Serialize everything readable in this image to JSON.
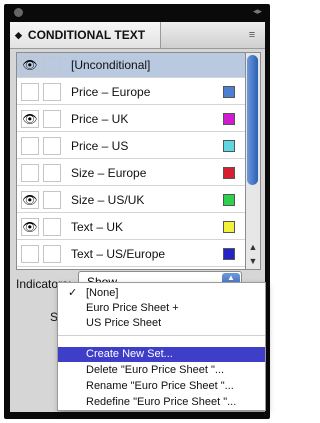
{
  "panel": {
    "title": "CONDITIONAL TEXT",
    "menu_icon": "panel-menu-icon"
  },
  "conditions": [
    {
      "label": "[Unconditional]",
      "visible": true,
      "highlighted": true,
      "color": null
    },
    {
      "label": "Price – Europe",
      "visible": false,
      "highlighted": false,
      "color": "#4a7fd4"
    },
    {
      "label": "Price – UK",
      "visible": true,
      "highlighted": false,
      "color": "#d21ad2"
    },
    {
      "label": "Price – US",
      "visible": false,
      "highlighted": false,
      "color": "#5fd7e0"
    },
    {
      "label": "Size – Europe",
      "visible": false,
      "highlighted": false,
      "color": "#d81f2f"
    },
    {
      "label": "Size – US/UK",
      "visible": true,
      "highlighted": false,
      "color": "#2ed14b"
    },
    {
      "label": "Text – UK",
      "visible": true,
      "highlighted": false,
      "color": "#f2f23a"
    },
    {
      "label": "Text – US/Europe",
      "visible": false,
      "highlighted": false,
      "color": "#2323c8"
    }
  ],
  "indicators": {
    "label": "Indicators:",
    "value": "Show"
  },
  "set": {
    "label_partial": "Se"
  },
  "set_menu": {
    "items": [
      {
        "label": "[None]",
        "checked": true
      },
      {
        "label": "Euro Price Sheet +",
        "checked": false
      },
      {
        "label": "US Price Sheet",
        "checked": false
      }
    ],
    "actions": [
      {
        "label": "Create New Set...",
        "selected": true
      },
      {
        "label": "Delete \"Euro Price Sheet \"...",
        "selected": false
      },
      {
        "label": "Rename \"Euro Price Sheet \"...",
        "selected": false
      },
      {
        "label": "Redefine \"Euro Price Sheet \"...",
        "selected": false
      }
    ]
  }
}
